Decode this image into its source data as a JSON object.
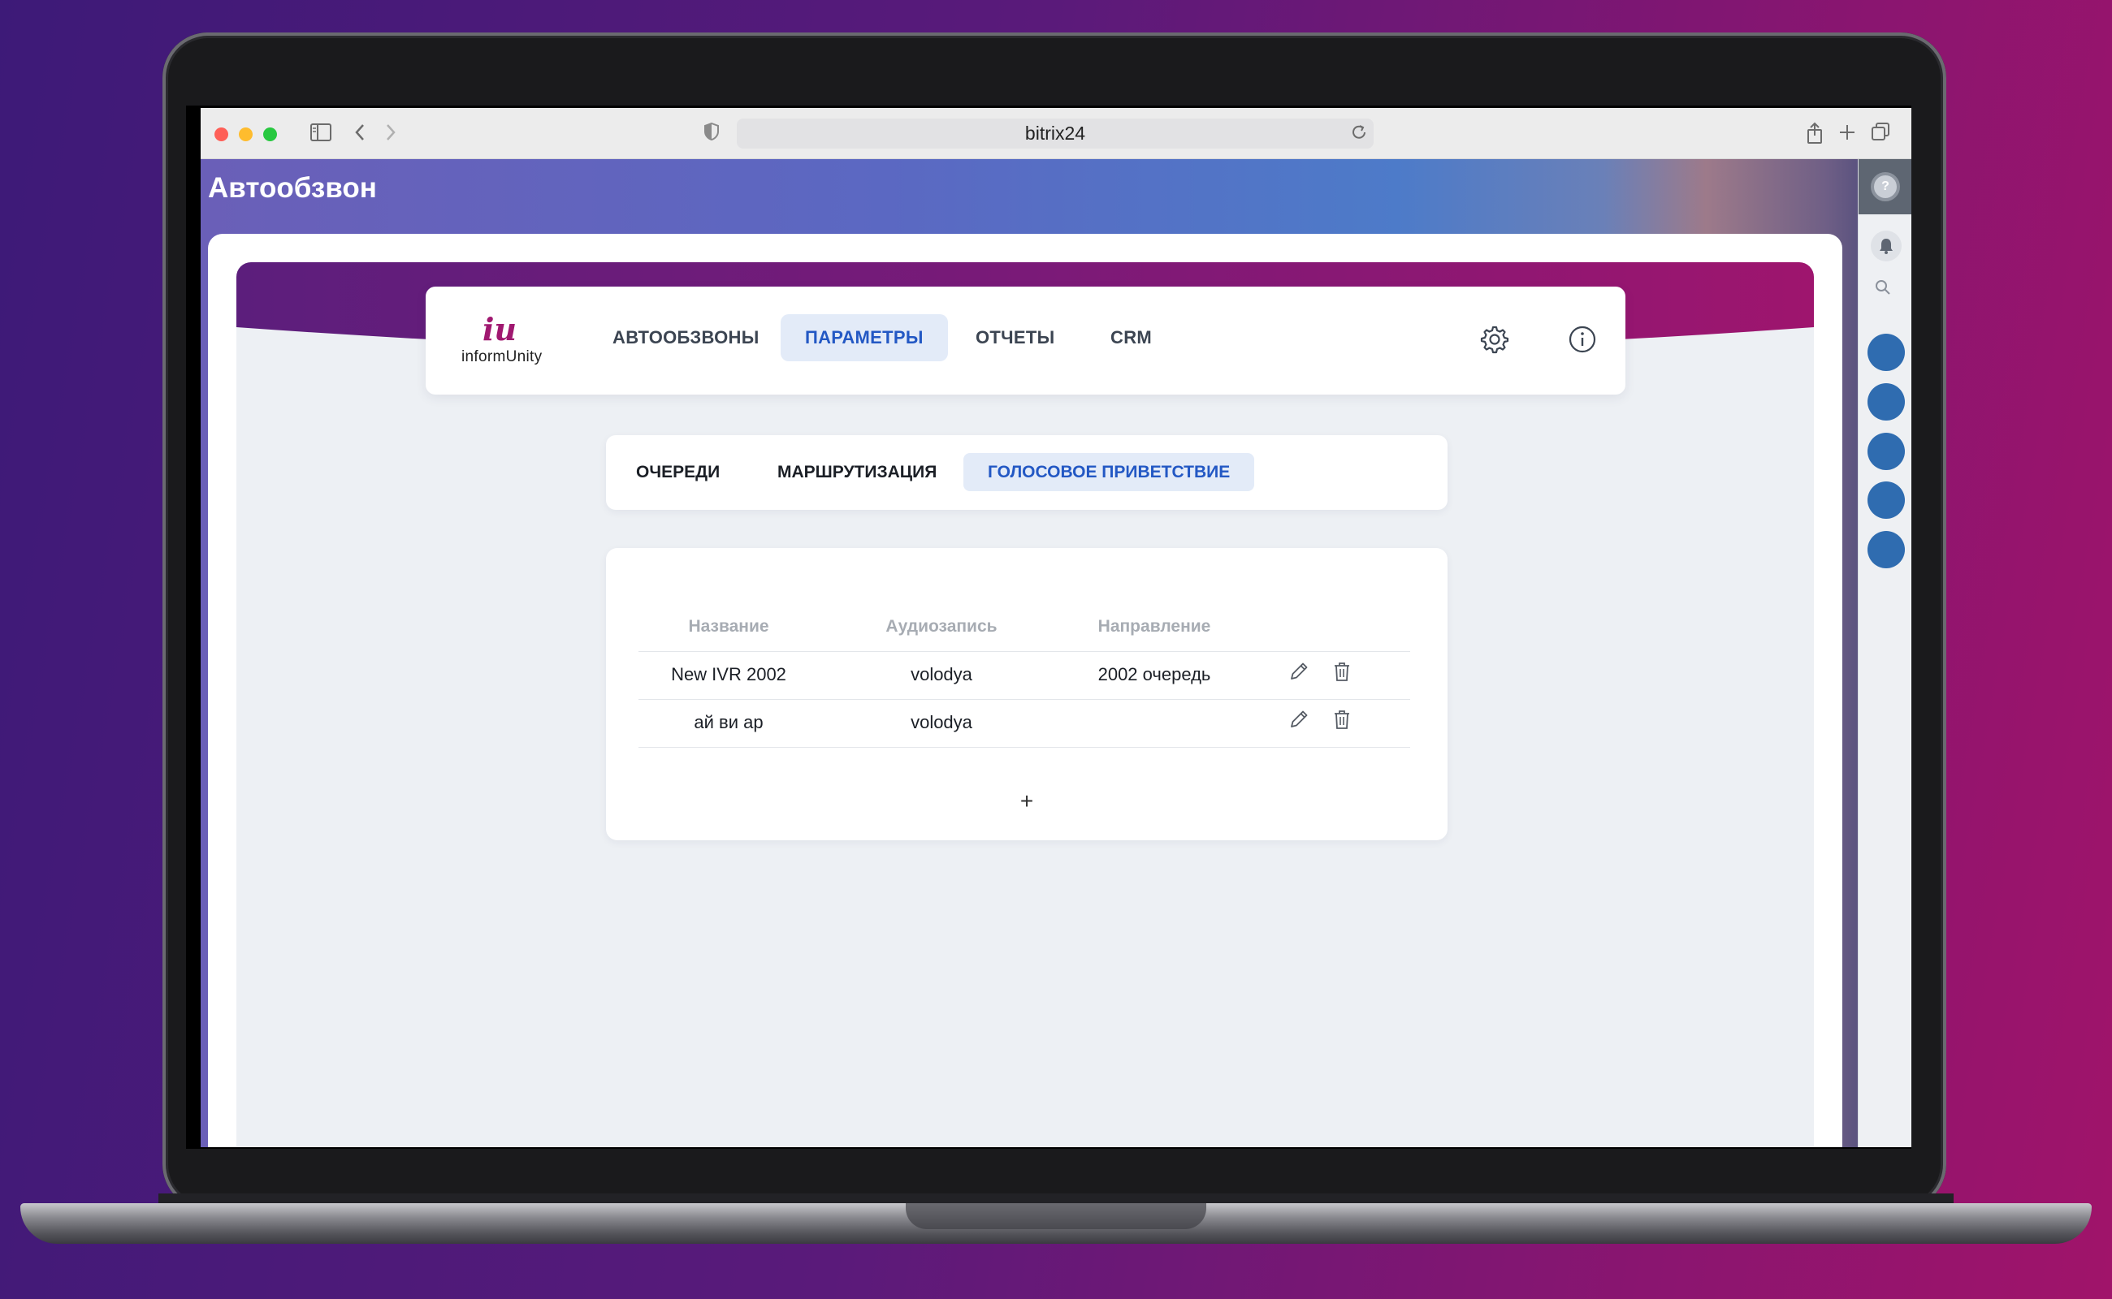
{
  "browser": {
    "url": "bitrix24"
  },
  "page": {
    "title": "Автообзвон"
  },
  "app": {
    "logo_text": "informUnity",
    "logo_mark": "iu",
    "nav": [
      {
        "label": "АВТООБЗВОНЫ",
        "active": false
      },
      {
        "label": "ПАРАМЕТРЫ",
        "active": true
      },
      {
        "label": "ОТЧЕТЫ",
        "active": false
      },
      {
        "label": "CRM",
        "active": false
      }
    ],
    "subtabs": [
      {
        "label": "ОЧЕРЕДИ",
        "active": false
      },
      {
        "label": "МАРШРУТИЗАЦИЯ",
        "active": false
      },
      {
        "label": "ГОЛОСОВОЕ ПРИВЕТСТВИЕ",
        "active": true
      }
    ],
    "table": {
      "columns": [
        "Название",
        "Аудиозапись",
        "Направление"
      ],
      "rows": [
        {
          "name": "New IVR 2002",
          "audio": "volodya",
          "direction": "2002 очередь"
        },
        {
          "name": "ай ви ар",
          "audio": "volodya",
          "direction": ""
        }
      ],
      "add_label": "+"
    }
  },
  "colors": {
    "accent": "#2358c4",
    "active_bg": "#e3ebf8",
    "brand": "#a01870",
    "avatar": "#2f6cb0"
  },
  "icons": {
    "settings": "gear-icon",
    "info": "info-icon",
    "edit": "pencil-icon",
    "delete": "trash-icon"
  }
}
